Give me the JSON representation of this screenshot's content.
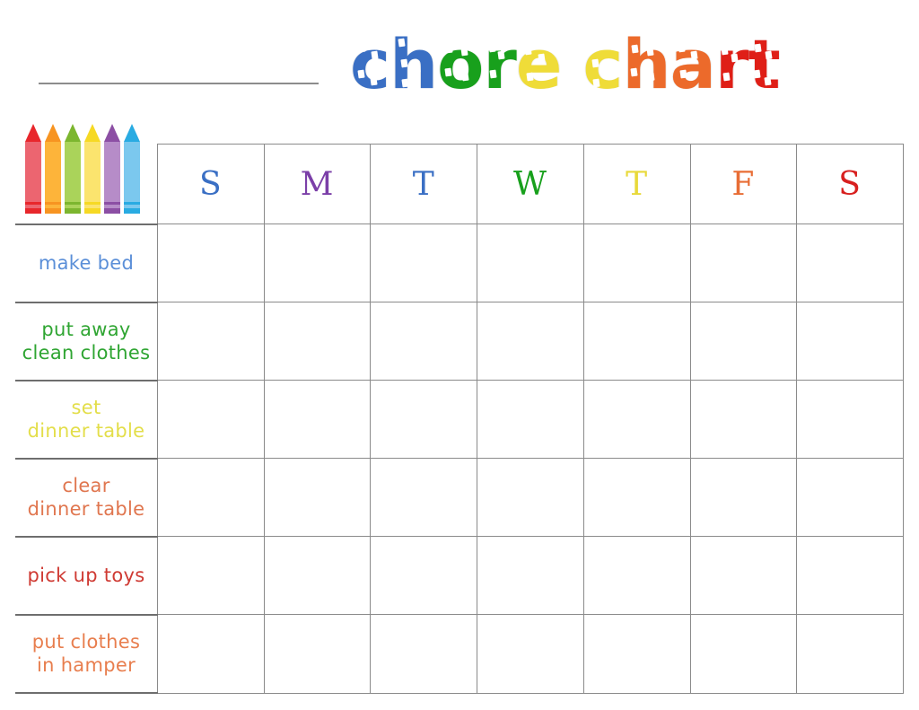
{
  "page": {
    "title": "chore chart",
    "background_color": "#ffffff",
    "grid_line_color": "#8a8a8a",
    "name_line_color": "#8c8c8c"
  },
  "title": {
    "text": "chore chart",
    "letters": [
      {
        "char": "c",
        "color": "#3a6fc4"
      },
      {
        "char": "h",
        "color": "#3a6fc4"
      },
      {
        "char": "o",
        "color": "#18a01c"
      },
      {
        "char": "r",
        "color": "#18a01c"
      },
      {
        "char": "e",
        "color": "#efdc38"
      },
      {
        "char": " ",
        "color": "#ffffff"
      },
      {
        "char": "c",
        "color": "#efdc38"
      },
      {
        "char": "h",
        "color": "#ec6a2b"
      },
      {
        "char": "a",
        "color": "#ec6a2b"
      },
      {
        "char": "r",
        "color": "#df1f17"
      },
      {
        "char": "t",
        "color": "#df1f17"
      }
    ]
  },
  "name_line": {
    "label": "",
    "value": ""
  },
  "crayons": [
    {
      "name": "red-crayon",
      "tip": "#e8272c",
      "body": "#ec6570",
      "band": "#e8272c"
    },
    {
      "name": "orange-crayon",
      "tip": "#f79421",
      "body": "#fdb43a",
      "band": "#f79421"
    },
    {
      "name": "green-crayon",
      "tip": "#7cb62f",
      "body": "#aad35a",
      "band": "#7cb62f"
    },
    {
      "name": "yellow-crayon",
      "tip": "#f6d924",
      "body": "#fbe46e",
      "band": "#f6d924"
    },
    {
      "name": "purple-crayon",
      "tip": "#8c4fa4",
      "body": "#b68cc8",
      "band": "#8c4fa4"
    },
    {
      "name": "blue-crayon",
      "tip": "#29abe2",
      "body": "#7bc8ee",
      "band": "#29abe2"
    }
  ],
  "table": {
    "days": [
      {
        "letter": "S",
        "day": "Sunday",
        "color": "#3a6fc4"
      },
      {
        "letter": "M",
        "day": "Monday",
        "color": "#7b3fa8"
      },
      {
        "letter": "T",
        "day": "Tuesday",
        "color": "#3a6fc4"
      },
      {
        "letter": "W",
        "day": "Wednesday",
        "color": "#18a01c"
      },
      {
        "letter": "T",
        "day": "Thursday",
        "color": "#e8d93a"
      },
      {
        "letter": "F",
        "day": "Friday",
        "color": "#e86d35"
      },
      {
        "letter": "S",
        "day": "Saturday",
        "color": "#d8201f"
      }
    ],
    "chores": [
      {
        "label": "make bed",
        "color": "#5b8fd8"
      },
      {
        "label": "put away\nclean clothes",
        "color": "#2fa532"
      },
      {
        "label": "set\ndinner table",
        "color": "#e3de4a"
      },
      {
        "label": "clear\ndinner table",
        "color": "#e0764f"
      },
      {
        "label": "pick up toys",
        "color": "#cf3a33"
      },
      {
        "label": "put clothes\nin hamper",
        "color": "#e87e4e"
      }
    ],
    "cells": [
      [
        "",
        "",
        "",
        "",
        "",
        "",
        ""
      ],
      [
        "",
        "",
        "",
        "",
        "",
        "",
        ""
      ],
      [
        "",
        "",
        "",
        "",
        "",
        "",
        ""
      ],
      [
        "",
        "",
        "",
        "",
        "",
        "",
        ""
      ],
      [
        "",
        "",
        "",
        "",
        "",
        "",
        ""
      ],
      [
        "",
        "",
        "",
        "",
        "",
        "",
        ""
      ]
    ]
  }
}
